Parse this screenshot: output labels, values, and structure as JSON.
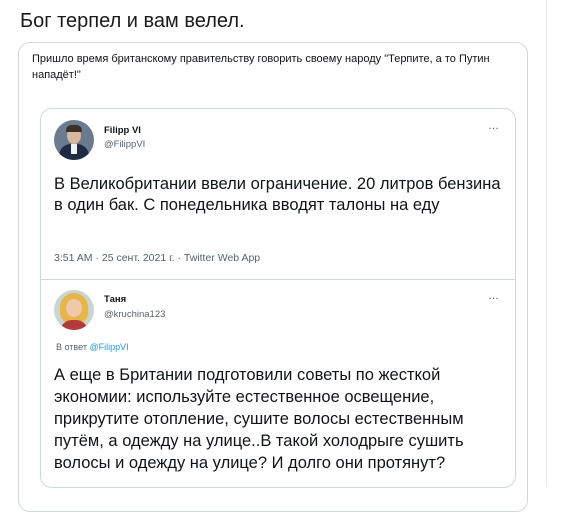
{
  "post": {
    "caption": "Бог терпел и вам велел."
  },
  "outer_tweet": {
    "text": "Пришло время британскому правительству говорить своему народу \"Терпите, а то Путин нападёт!\""
  },
  "quoted_tweet": {
    "display_name": "Filipp VI",
    "handle": "@FilippVI",
    "more_icon": "…",
    "text": "В Великобритании ввели ограничение. 20 литров бензина в один бак. С понедельника вводят талоны на еду",
    "meta": "3:51 AM · 25 сент. 2021 г. · Twitter Web App"
  },
  "reply_tweet": {
    "display_name": "Таня",
    "handle": "@kruchina123",
    "more_icon": "…",
    "reply_prefix": "В ответ",
    "reply_to": "@FilippVI",
    "text": "А еще  в Британии подготовили советы по жесткой экономии: используйте естественное освещение, прикрутите отопление, сушите волосы естественным путём, а одежду на улице..В такой холодрыге сушить волосы и одежду на улице? И долго они протянут?"
  },
  "icons": {
    "avatar_filipp": "avatar-icon",
    "avatar_tanya": "avatar-icon",
    "more": "more-options-icon"
  },
  "colors": {
    "link": "#1d9bf0",
    "secondary_text": "#536471",
    "border": "#cfd9de"
  }
}
